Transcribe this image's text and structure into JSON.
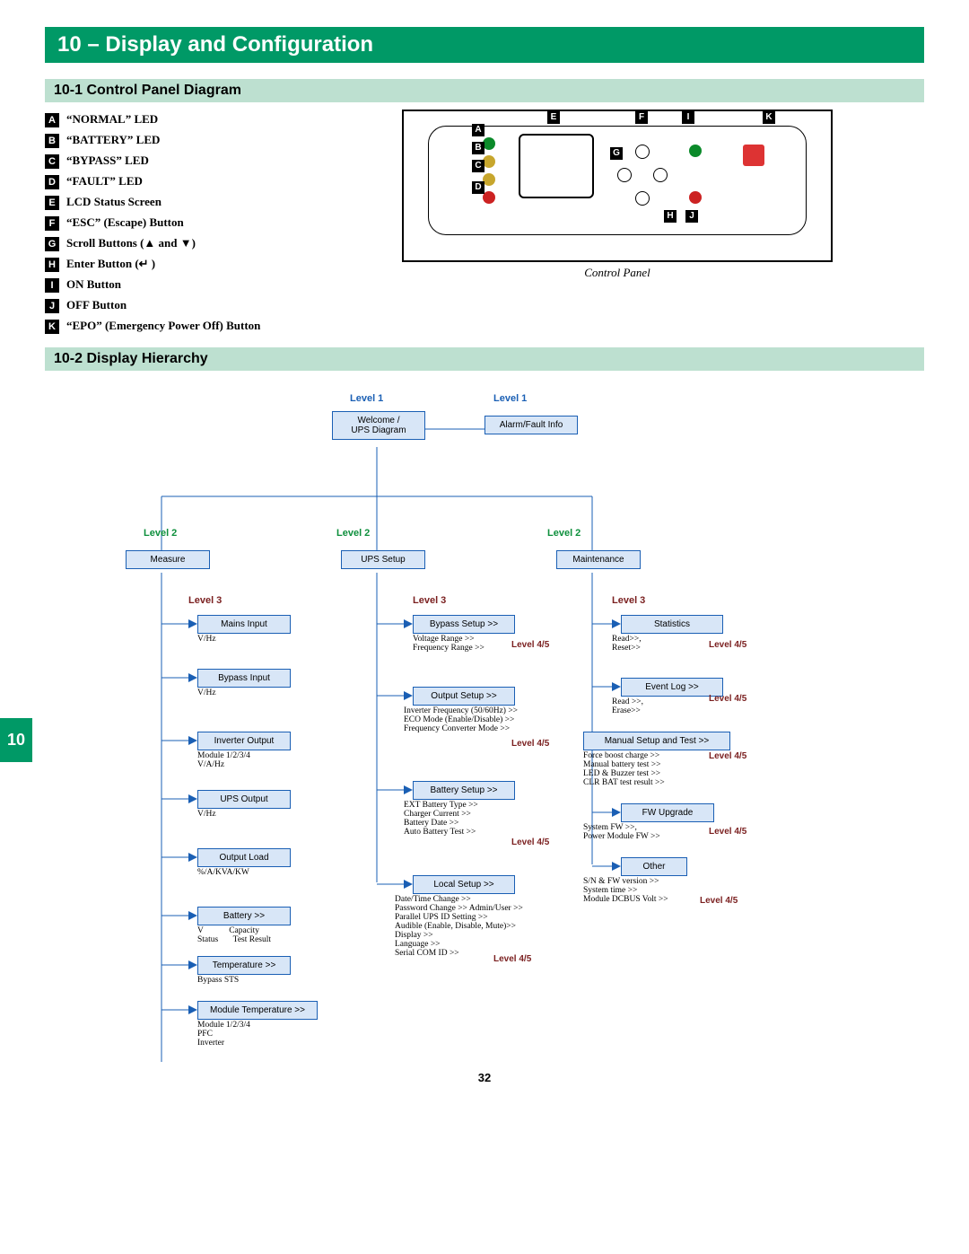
{
  "title": "10 – Display and Configuration",
  "section1": "10-1 Control Panel Diagram",
  "section2": "10-2 Display Hierarchy",
  "page_number": "32",
  "side_tab": "10",
  "panel_caption": "Control Panel",
  "legend": [
    {
      "k": "A",
      "t": "“NORMAL” LED"
    },
    {
      "k": "B",
      "t": "“BATTERY” LED"
    },
    {
      "k": "C",
      "t": "“BYPASS” LED"
    },
    {
      "k": "D",
      "t": "“FAULT” LED"
    },
    {
      "k": "E",
      "t": "LCD Status Screen"
    },
    {
      "k": "F",
      "t": "“ESC” (Escape) Button"
    },
    {
      "k": "G",
      "t": "Scroll Buttons (▲ and ▼)"
    },
    {
      "k": "H",
      "t": "Enter Button (↵ )"
    },
    {
      "k": "I",
      "t": "ON Button"
    },
    {
      "k": "J",
      "t": "OFF Button"
    },
    {
      "k": "K",
      "t": "“EPO” (Emergency Power Off) Button"
    }
  ],
  "callouts": {
    "A": "A",
    "B": "B",
    "C": "C",
    "D": "D",
    "E": "E",
    "F": "F",
    "G": "G",
    "H": "H",
    "I": "I",
    "J": "J",
    "K": "K"
  },
  "hierarchy": {
    "level1a": "Level 1",
    "level1b": "Level 1",
    "welcome": "Welcome /\nUPS Diagram",
    "alarm": "Alarm/Fault Info",
    "level2": "Level  2",
    "level2b": "Level  2",
    "level2c": "Level  2",
    "measure": "Measure",
    "ups_setup": "UPS Setup",
    "maintenance": "Maintenance",
    "level3a": "Level 3",
    "level3b": "Level 3",
    "level3c": "Level 3",
    "level45": "Level 4/5",
    "measure_items": {
      "mains": "Mains Input",
      "mains_sub": "V/Hz",
      "bypass": "Bypass Input",
      "bypass_sub": "V/Hz",
      "inverter": "Inverter Output",
      "inverter_sub": "Module 1/2/3/4\nV/A/Hz",
      "ups_out": "UPS Output",
      "ups_out_sub": "V/Hz",
      "out_load": "Output Load",
      "out_load_sub": "%/A/KVA/KW",
      "battery": "Battery >>",
      "battery_sub": "V            Capacity\nStatus       Test Result",
      "temp": "Temperature >>",
      "temp_sub": "Bypass STS",
      "modtemp": "Module Temperature >>",
      "modtemp_sub": "Module 1/2/3/4\nPFC\nInverter"
    },
    "setup_items": {
      "bypass": "Bypass Setup  >>",
      "bypass_sub": "Voltage Range >>\nFrequency Range >>",
      "output": "Output Setup  >>",
      "output_sub": "Inverter Frequency (50/60Hz) >>\nECO Mode (Enable/Disable) >>\nFrequency Converter Mode  >>",
      "battery": "Battery Setup  >>",
      "battery_sub": "EXT Battery Type >>\nCharger Current >>\nBattery Date >>\nAuto Battery Test >>",
      "local": "Local Setup   >>",
      "local_sub": "Date/Time Change >>\nPassword Change >> Admin/User >>\nParallel UPS ID Setting  >>\nAudible (Enable, Disable, Mute)>>\nDisplay >>\nLanguage >>\nSerial COM ID >>"
    },
    "maint_items": {
      "stats": "Statistics",
      "stats_sub": "Read>>,\nReset>>",
      "eventlog": "Event Log  >>",
      "eventlog_sub": "Read >>,\nErase>>",
      "manual": "Manual Setup and Test >>",
      "manual_sub": "Force boost charge >>\nManual battery test >>\nLED & Buzzer test >>\nCLR BAT test result  >>",
      "fw": "FW Upgrade",
      "fw_sub": "System FW >>,\nPower Module FW  >>",
      "other": "Other",
      "other_sub": "S/N & FW version >>\nSystem time >>\nModule DCBUS Volt  >>"
    }
  }
}
